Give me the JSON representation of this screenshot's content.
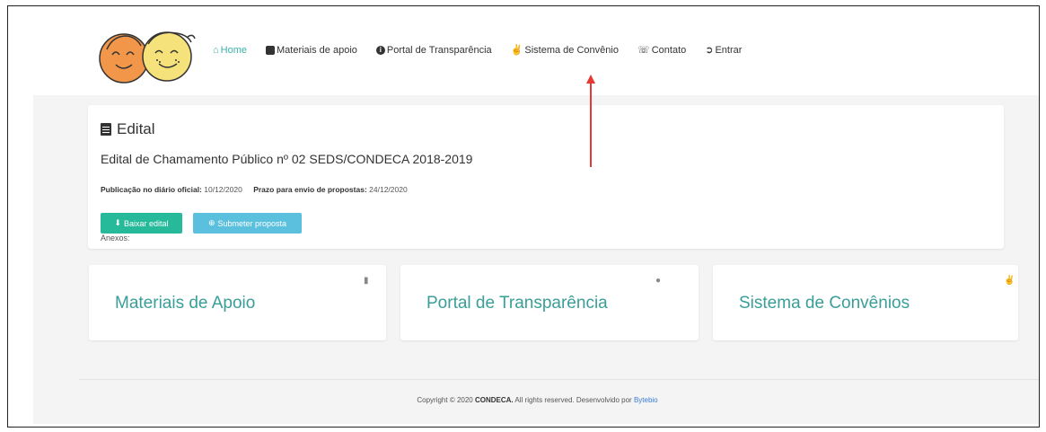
{
  "nav": {
    "home": "Home",
    "materiais": "Materiais de apoio",
    "portal": "Portal de Transparência",
    "sistema": "Sistema de Convênio",
    "contato": "Contato",
    "entrar": "Entrar"
  },
  "edital": {
    "heading": "Edital",
    "title": "Edital de Chamamento Público nº 02 SEDS/CONDECA 2018-2019",
    "pub_label": "Publicação no diário oficial:",
    "pub_value": "10/12/2020",
    "prazo_label": "Prazo para envio de propostas:",
    "prazo_value": "24/12/2020",
    "btn_baixar": "Baixar edital",
    "btn_submeter": "Submeter proposta",
    "anexos": "Anexos:"
  },
  "tiles": {
    "materiais": "Materiais de Apoio",
    "portal": "Portal de Transparência",
    "sistema": "Sistema de Convênios"
  },
  "footer": {
    "prefix": "Copyright © 2020",
    "org": "CONDECA.",
    "rights": "All rights reserved. Desenvolvido por",
    "dev": "Bytebio"
  },
  "colors": {
    "accent": "#3a9e98",
    "green_button": "#26b99a",
    "blue_button": "#5bc0de",
    "annotation_arrow": "#e53935"
  }
}
